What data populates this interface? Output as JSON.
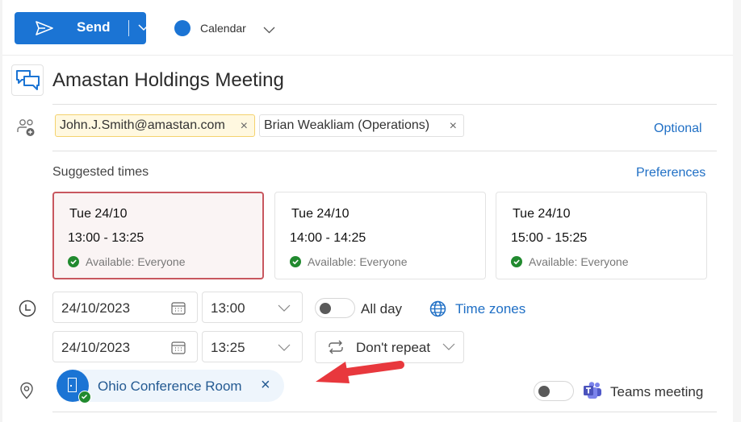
{
  "toolbar": {
    "send_label": "Send",
    "calendar_label": "Calendar",
    "calendar_color": "#1b74d4"
  },
  "event": {
    "title": "Amastan Holdings Meeting"
  },
  "attendees": {
    "chips": [
      {
        "label": "John.J.Smith@amastan.com",
        "remove": "×"
      },
      {
        "label": "Brian Weakliam (Operations)",
        "remove": "×"
      }
    ],
    "optional_label": "Optional"
  },
  "suggested": {
    "label": "Suggested times",
    "preferences_label": "Preferences",
    "slots": [
      {
        "day": "Tue 24/10",
        "time": "13:00 - 13:25",
        "availability": "Available: Everyone",
        "selected": true
      },
      {
        "day": "Tue 24/10",
        "time": "14:00 - 14:25",
        "availability": "Available: Everyone",
        "selected": false
      },
      {
        "day": "Tue 24/10",
        "time": "15:00 - 15:25",
        "availability": "Available: Everyone",
        "selected": false
      }
    ]
  },
  "schedule": {
    "start_date": "24/10/2023",
    "start_time": "13:00",
    "end_date": "24/10/2023",
    "end_time": "13:25",
    "all_day_label": "All day",
    "all_day_on": false,
    "time_zones_label": "Time zones",
    "repeat_label": "Don't repeat"
  },
  "location": {
    "room_name": "Ohio Conference Room",
    "remove": "×"
  },
  "teams": {
    "label": "Teams meeting",
    "enabled": false
  },
  "colors": {
    "accent": "#1b74d4",
    "link": "#1f6fc5",
    "available_green": "#218a2f",
    "selected_border": "#c8575f",
    "annotation_arrow": "#e8383d"
  }
}
